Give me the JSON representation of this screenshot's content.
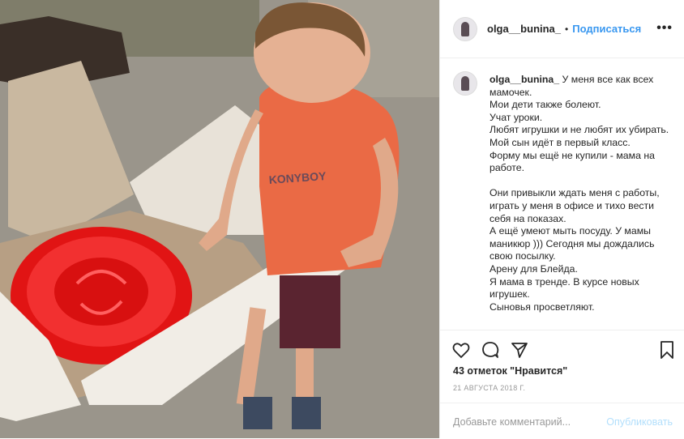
{
  "post": {
    "username": "olga__bunina_",
    "separator": "•",
    "follow_label": "Подписаться",
    "more_label": "•••",
    "caption": "У меня все как всех мамочек.\nМои дети также болеют.\nУчат уроки.\nЛюбят игрушки и не любят их убирать.\nМой сын идёт в первый класс.\nФорму мы ещё не купили - мама на работе.\n\nОни привыкли ждать меня с работы, играть у меня в офисе и тихо вести себя на показах.\nА ещё умеют мыть посуду. У мамы маникюр ))) Сегодня мы дождались свою посылку.\nАрену для Блейда.\nЯ мама в тренде. В курсе новых игрушек.\nСыновья просветляют.",
    "likes_text": "43 отметок \"Нравится\"",
    "date_text": "21 АВГУСТА 2018 Г.",
    "comment_placeholder": "Добавьте комментарий...",
    "publish_label": "Опубликовать"
  },
  "icons": {
    "like": "heart-icon",
    "comment": "comment-bubble-icon",
    "share": "share-icon",
    "save": "bookmark-icon"
  },
  "photo": {
    "shirt_text": "KONYBOY"
  }
}
